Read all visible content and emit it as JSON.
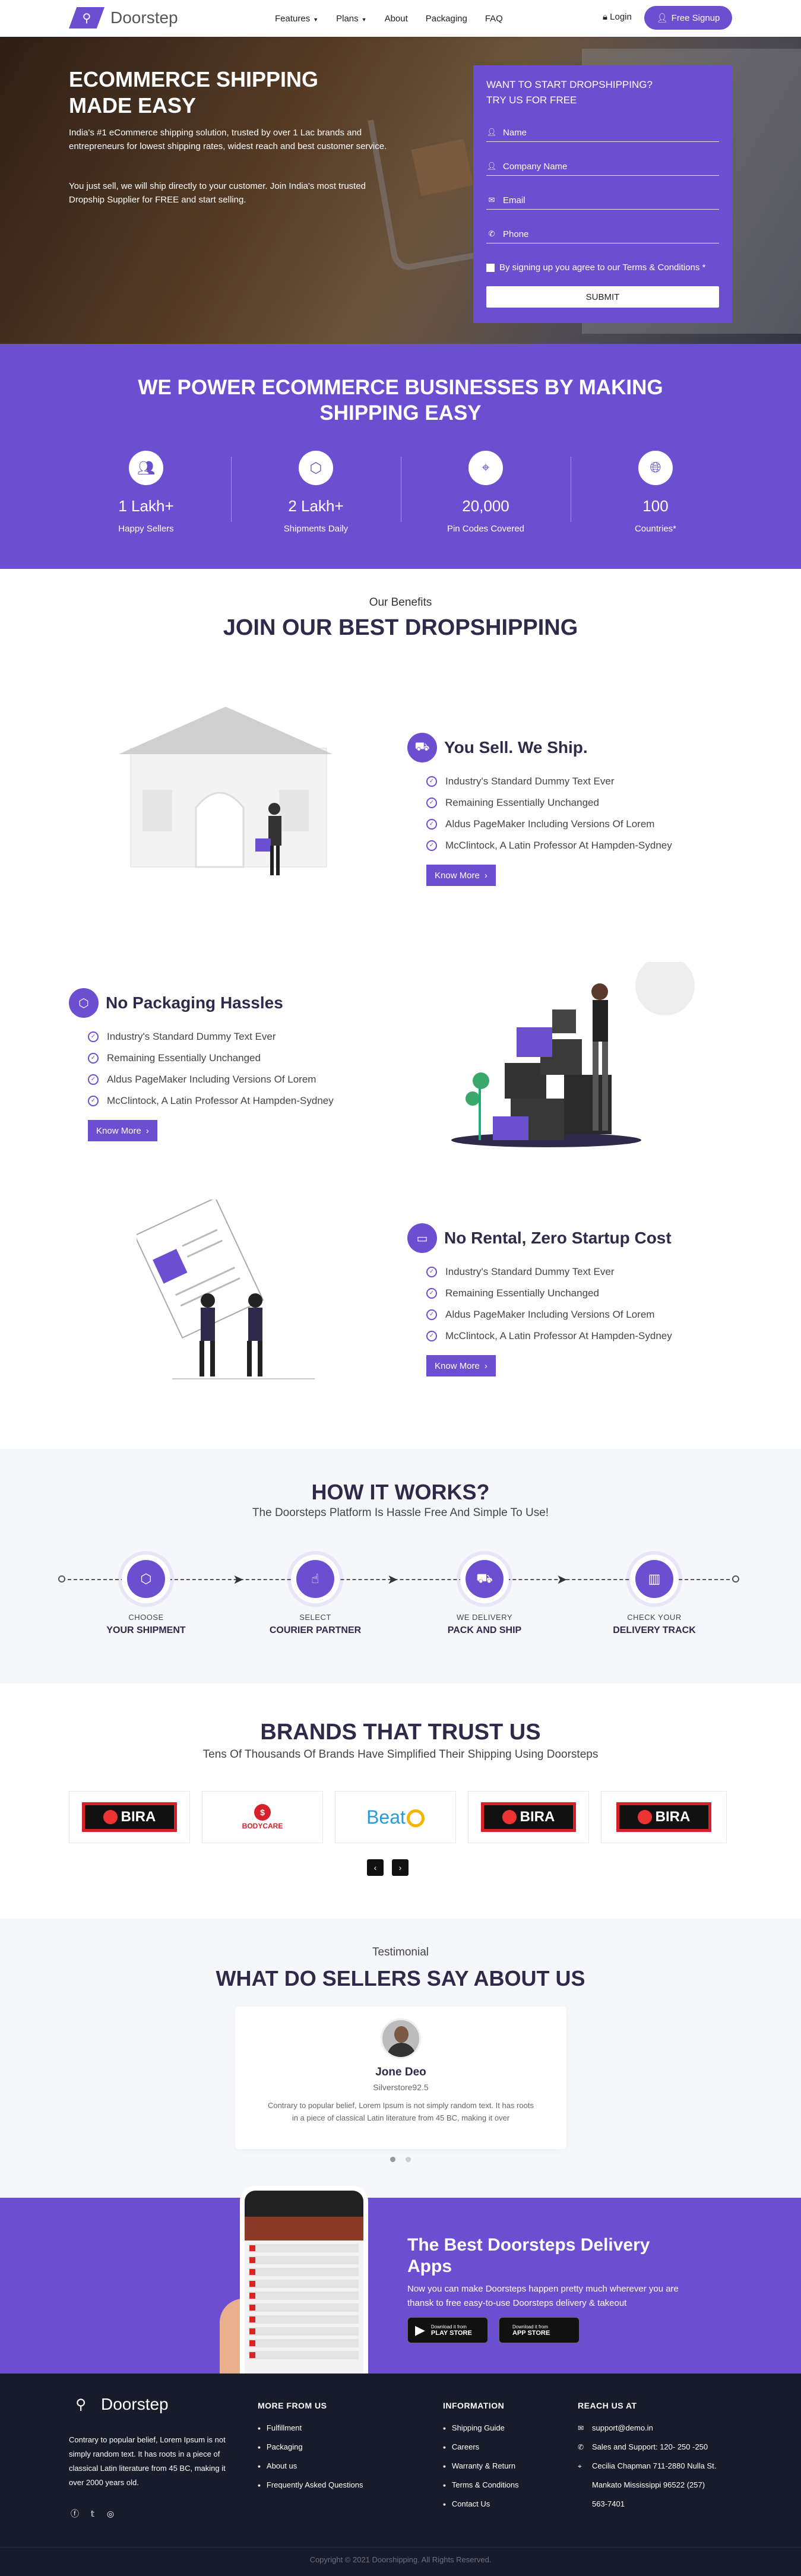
{
  "nav": {
    "brand": "Doorstep",
    "menu": [
      "Features",
      "Plans",
      "About",
      "Packaging",
      "FAQ"
    ],
    "login": "Login",
    "signup": "Free Signup"
  },
  "hero": {
    "title": "ECOMMERCE SHIPPING MADE EASY",
    "p1": "India's #1 eCommerce shipping solution, trusted by over 1 Lac brands and entrepreneurs for lowest shipping rates, widest reach and best customer service.",
    "p2": "You just sell, we will ship directly to your customer. Join India's most trusted Dropship Supplier for FREE and start selling.",
    "form": {
      "title_line1": "WANT TO START DROPSHIPPING?",
      "title_line2": "TRY US FOR FREE",
      "name": "Name",
      "company": "Company Name",
      "email": "Email",
      "phone": "Phone",
      "terms": "By signing up you agree to our Terms & Conditions *",
      "submit": "SUBMIT"
    }
  },
  "stats": {
    "title": "WE POWER ECOMMERCE BUSINESSES BY MAKING SHIPPING EASY",
    "items": [
      {
        "icon": "users-icon",
        "num": "1 Lakh+",
        "label": "Happy Sellers"
      },
      {
        "icon": "box-icon",
        "num": "2 Lakh+",
        "label": "Shipments Daily"
      },
      {
        "icon": "map-pin-icon",
        "num": "20,000",
        "label": "Pin Codes Covered"
      },
      {
        "icon": "globe-icon",
        "num": "100",
        "label": "Countries*"
      }
    ]
  },
  "benefits": {
    "subtitle": "Our Benefits",
    "title": "JOIN OUR BEST DROPSHIPPING",
    "features": [
      {
        "title": "You Sell. We Ship.",
        "icon": "truck-icon",
        "items": [
          "Industry's Standard Dummy Text Ever",
          "Remaining Essentially Unchanged",
          "Aldus PageMaker Including Versions Of Lorem",
          "McClintock, A Latin Professor At Hampden-Sydney"
        ],
        "button": "Know More"
      },
      {
        "title": "No Packaging Hassles",
        "icon": "package-icon",
        "items": [
          "Industry's Standard Dummy Text Ever",
          "Remaining Essentially Unchanged",
          "Aldus PageMaker Including Versions Of Lorem",
          "McClintock, A Latin Professor At Hampden-Sydney"
        ],
        "button": "Know More"
      },
      {
        "title": "No Rental, Zero Startup Cost",
        "icon": "card-icon",
        "items": [
          "Industry's Standard Dummy Text Ever",
          "Remaining Essentially Unchanged",
          "Aldus PageMaker Including Versions Of Lorem",
          "McClintock, A Latin Professor At Hampden-Sydney"
        ],
        "button": "Know More"
      }
    ]
  },
  "how": {
    "title": "HOW IT WORKS?",
    "subtitle": "The Doorsteps Platform Is Hassle Free And Simple To Use!",
    "steps": [
      {
        "top": "CHOOSE",
        "bottom": "YOUR SHIPMENT",
        "icon": "box-icon"
      },
      {
        "top": "SELECT",
        "bottom": "COURIER PARTNER",
        "icon": "hand-pointer-icon"
      },
      {
        "top": "WE DELIVERY",
        "bottom": "PACK AND SHIP",
        "icon": "truck-icon"
      },
      {
        "top": "CHECK YOUR",
        "bottom": "DELIVERY TRACK",
        "icon": "columns-icon"
      }
    ]
  },
  "brands": {
    "title": "BRANDS THAT TRUST US",
    "subtitle": "Tens Of Thousands Of Brands Have Simplified Their Shipping Using Doorsteps",
    "logos": [
      "BIRA",
      "BODYCARE",
      "Beat",
      "BIRA",
      "BIRA"
    ],
    "prev": "‹",
    "next": "›"
  },
  "testimonial": {
    "subtitle": "Testimonial",
    "title": "WHAT DO SELLERS SAY ABOUT US",
    "name": "Jone Deo",
    "handle": "Silverstore92.5",
    "text": "Contrary to popular belief, Lorem Ipsum is not simply random text. It has roots in a piece of classical Latin literature from 45 BC, making it over"
  },
  "app": {
    "title": "The Best Doorsteps Delivery Apps",
    "text": "Now you can make Doorsteps happen pretty much wherever you are thansk to free easy-to-use Doorsteps delivery & takeout",
    "play_small": "Download it from",
    "play_big": "PLAY STORE",
    "apple_small": "Download it from",
    "apple_big": "APP STORE"
  },
  "footer": {
    "brand": "Doorstep",
    "about": "Contrary to popular belief, Lorem Ipsum is not simply random text. It has roots in a piece of classical Latin literature from 45 BC, making it over 2000 years old.",
    "more_title": "MORE FROM US",
    "more": [
      "Fulfillment",
      "Packaging",
      "About us",
      "Frequently Asked Questions"
    ],
    "info_title": "INFORMATION",
    "info": [
      "Shipping Guide",
      "Careers",
      "Warranty & Return",
      "Terms & Conditions",
      "Contact Us"
    ],
    "reach_title": "REACH US AT",
    "email": "support@demo.in",
    "phone": "Sales and Support: 120- 250 -250",
    "address1": "Cecilia Chapman 711-2880 Nulla St.",
    "address2": "Mankato Mississippi 96522 (257)",
    "address3": "563-7401",
    "copyright": "Copyright © 2021 Doorshipping. All Rights Reserved."
  }
}
